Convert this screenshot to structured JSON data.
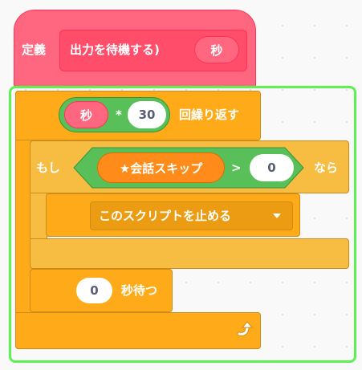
{
  "define_block": {
    "keyword": "定義",
    "proc_label": "出力を待機する)",
    "param": "秒"
  },
  "repeat_block": {
    "reporter_param": "秒",
    "operator": "*",
    "operand": "30",
    "label": "回繰り返す"
  },
  "if_block": {
    "prefix": "もし",
    "condition_variable": "★会話スキップ",
    "comparator": ">",
    "comparison_value": "0",
    "suffix": "なら"
  },
  "stop_block": {
    "selected_option": "このスクリプトを止める"
  },
  "wait_block": {
    "value": "0",
    "label": "秒待つ"
  },
  "colors": {
    "define_pink": "#ff6680",
    "control_orange": "#ffab19",
    "operator_green": "#59c059",
    "variable_orange": "#ff8c1a",
    "selection_outline": "#5cf252"
  },
  "icons": {
    "dropdown": "caret-down-icon",
    "loop_arrow": "repeat-arrow-icon"
  }
}
